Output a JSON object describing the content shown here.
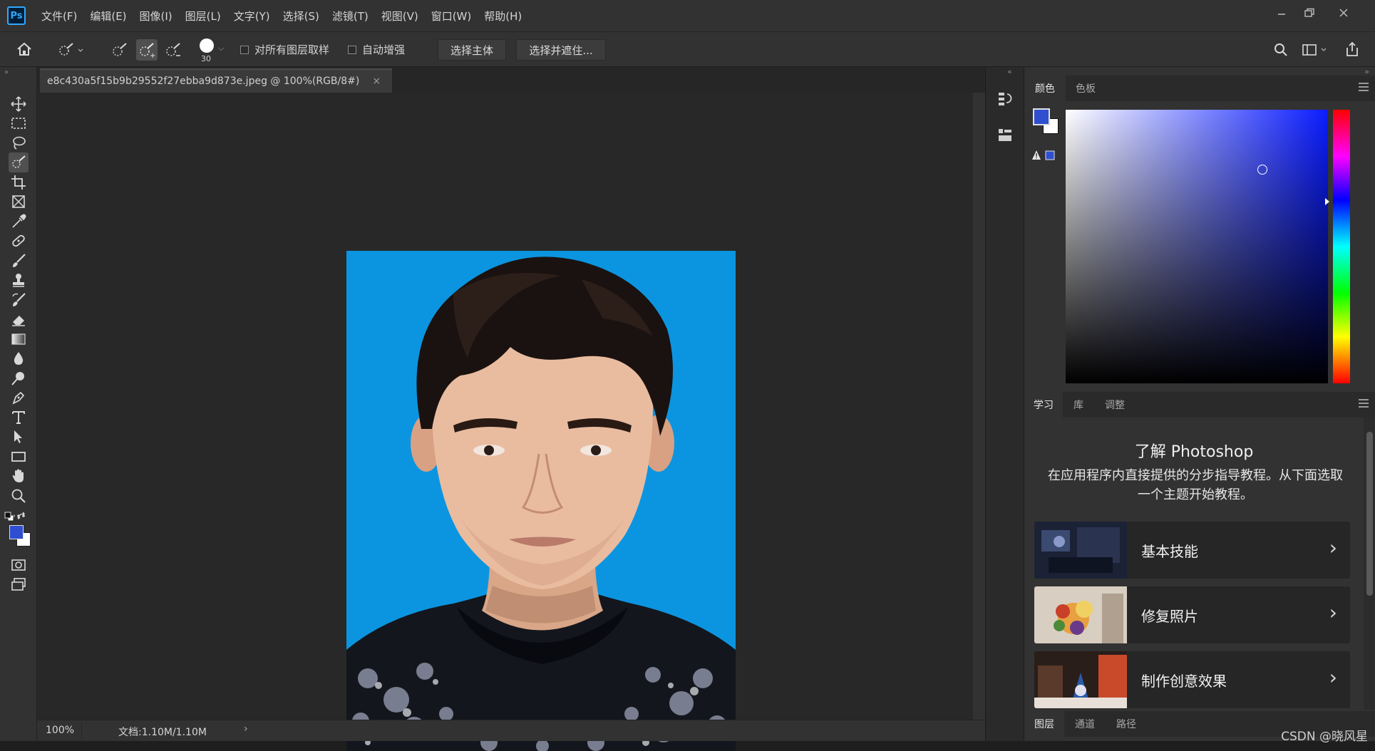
{
  "app": {
    "logo": "Ps"
  },
  "menu": [
    "文件(F)",
    "编辑(E)",
    "图像(I)",
    "图层(L)",
    "文字(Y)",
    "选择(S)",
    "滤镜(T)",
    "视图(V)",
    "窗口(W)",
    "帮助(H)"
  ],
  "options": {
    "brush_size": "30",
    "sample_all_layers": "对所有图层取样",
    "auto_enhance": "自动增强",
    "select_subject": "选择主体",
    "select_and_mask": "选择并遮住..."
  },
  "document": {
    "tab_title": "e8c430a5f15b9b29552f27ebba9d873e.jpeg @ 100%(RGB/8#)",
    "close": "×",
    "zoom": "100%",
    "doc_size": "文档:1.10M/1.10M",
    "background_color": "#0b95e0"
  },
  "color_panel": {
    "tabs": [
      "颜色",
      "色板"
    ],
    "foreground": "#2f4fd0",
    "background": "#ffffff"
  },
  "learn_panel": {
    "tabs": [
      "学习",
      "库",
      "调整"
    ],
    "heading": "了解 Photoshop",
    "description": "在应用程序内直接提供的分步指导教程。从下面选取一个主题开始教程。",
    "items": [
      "基本技能",
      "修复照片",
      "制作创意效果"
    ]
  },
  "layers_panel": {
    "tabs": [
      "图层",
      "通道",
      "路径"
    ]
  },
  "watermark": "CSDN @晓风星"
}
